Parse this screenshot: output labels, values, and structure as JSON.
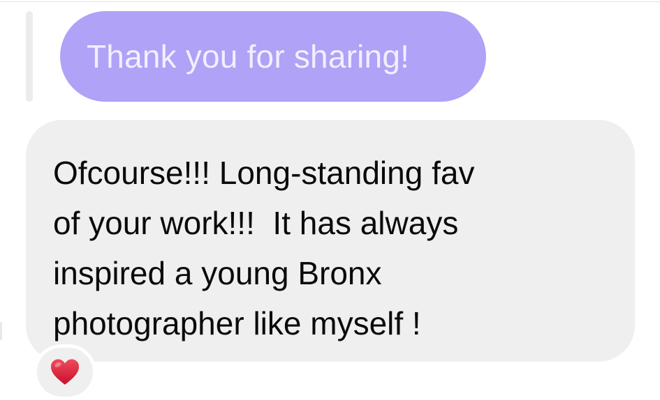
{
  "conversation": {
    "sent_message": {
      "text": "Thank you for sharing!"
    },
    "received_message": {
      "lines": [
        "Ofcourse!!! Long-standing fav",
        "of your work!!!  It has always",
        "inspired a young Bronx",
        "photographer like myself !"
      ]
    },
    "reaction": {
      "icon": "heart-icon",
      "color": "#e0243a"
    }
  },
  "colors": {
    "sent_bubble": "#b0a2f6",
    "sent_text": "#f2efff",
    "received_bubble": "#efeff0",
    "received_text": "#0a0a0a"
  }
}
